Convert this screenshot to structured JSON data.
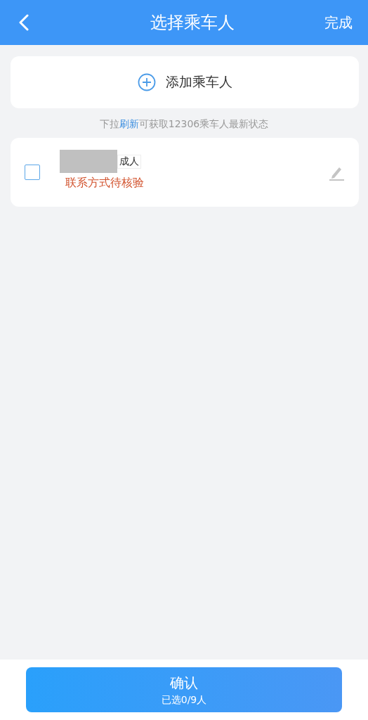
{
  "header": {
    "title": "选择乘车人",
    "done": "完成"
  },
  "add_button": {
    "label": "添加乘车人"
  },
  "hint": {
    "before": "下拉",
    "link": "刷新",
    "after": "可获取12306乘车人最新状态"
  },
  "passengers": [
    {
      "type": "成人",
      "status": "联系方式待核验",
      "checked": false,
      "name_redacted": true
    }
  ],
  "confirm": {
    "label": "确认",
    "count": "已选0/9人"
  }
}
